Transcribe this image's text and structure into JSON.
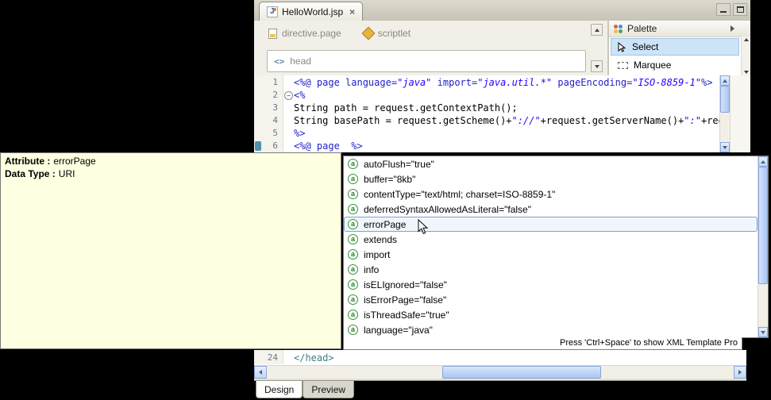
{
  "icons": {
    "close": "×",
    "jsp": "J",
    "head_tags": "<>",
    "attr": "a",
    "fold": "−"
  },
  "colors": {
    "selection_outline": "#7DA2CE",
    "palette_selection_bg": "#CDE3F7",
    "tooltip_bg": "#FFFFE1",
    "attr_icon_green": "#2F7D2F",
    "scrollbar_thumb_blue": "#A9C6F1",
    "code_directive_blue": "#2121C8",
    "code_string_blue": "#2A00FF",
    "code_tag_teal": "#3F7F7F"
  },
  "tab": {
    "title": "HelloWorld.jsp"
  },
  "toolbar": {
    "breadcrumb": [
      {
        "label": "directive.page"
      },
      {
        "label": "scriptlet"
      }
    ],
    "node": "head"
  },
  "palette": {
    "title": "Palette",
    "items": [
      {
        "label": "Select",
        "selected": true
      },
      {
        "label": "Marquee",
        "selected": false
      }
    ]
  },
  "editor": {
    "lines": [
      {
        "num": "1",
        "segments": [
          [
            "<%@ page ",
            "dir"
          ],
          [
            "language=",
            "attr"
          ],
          [
            "\"java\"",
            "str"
          ],
          [
            " ",
            "plain"
          ],
          [
            "import=",
            "attr"
          ],
          [
            "\"java.util.*\"",
            "str"
          ],
          [
            " ",
            "plain"
          ],
          [
            "pageEncoding=",
            "attr"
          ],
          [
            "\"ISO-8859-1\"",
            "str"
          ],
          [
            "%>",
            "dir"
          ]
        ]
      },
      {
        "num": "2",
        "fold": true,
        "segments": [
          [
            "<%",
            "dir"
          ]
        ]
      },
      {
        "num": "3",
        "segments": [
          [
            "String path = request.getContextPath();",
            "plain"
          ]
        ]
      },
      {
        "num": "4",
        "segments": [
          [
            "String basePath = request.getScheme()+",
            "plain"
          ],
          [
            "\"://\"",
            "str"
          ],
          [
            "+request.getServerName()+",
            "plain"
          ],
          [
            "\":\"",
            "str"
          ],
          [
            "+reques",
            "plain"
          ]
        ]
      },
      {
        "num": "5",
        "segments": [
          [
            "%>",
            "dir"
          ]
        ]
      },
      {
        "num": "6",
        "current": true,
        "segments": [
          [
            "<%@ page  %>",
            "dir"
          ]
        ]
      }
    ],
    "bottom_line": {
      "num": "24",
      "segments": [
        [
          "</head>",
          "tag"
        ]
      ]
    }
  },
  "tooltip": {
    "rows": [
      {
        "label": "Attribute :",
        "value": "errorPage"
      },
      {
        "label": "Data Type :",
        "value": "URI"
      }
    ]
  },
  "autocomplete": {
    "items": [
      {
        "label": "autoFlush=\"true\"",
        "selected": false
      },
      {
        "label": "buffer=\"8kb\"",
        "selected": false
      },
      {
        "label": "contentType=\"text/html; charset=ISO-8859-1\"",
        "selected": false
      },
      {
        "label": "deferredSyntaxAllowedAsLiteral=\"false\"",
        "selected": false
      },
      {
        "label": "errorPage",
        "selected": true
      },
      {
        "label": "extends",
        "selected": false
      },
      {
        "label": "import",
        "selected": false
      },
      {
        "label": "info",
        "selected": false
      },
      {
        "label": "isELIgnored=\"false\"",
        "selected": false
      },
      {
        "label": "isErrorPage=\"false\"",
        "selected": false
      },
      {
        "label": "isThreadSafe=\"true\"",
        "selected": false
      },
      {
        "label": "language=\"java\"",
        "selected": false
      }
    ],
    "status": "Press 'Ctrl+Space' to show XML Template Pro"
  },
  "bottom_tabs": [
    {
      "label": "Design",
      "active": true
    },
    {
      "label": "Preview",
      "active": false
    }
  ]
}
